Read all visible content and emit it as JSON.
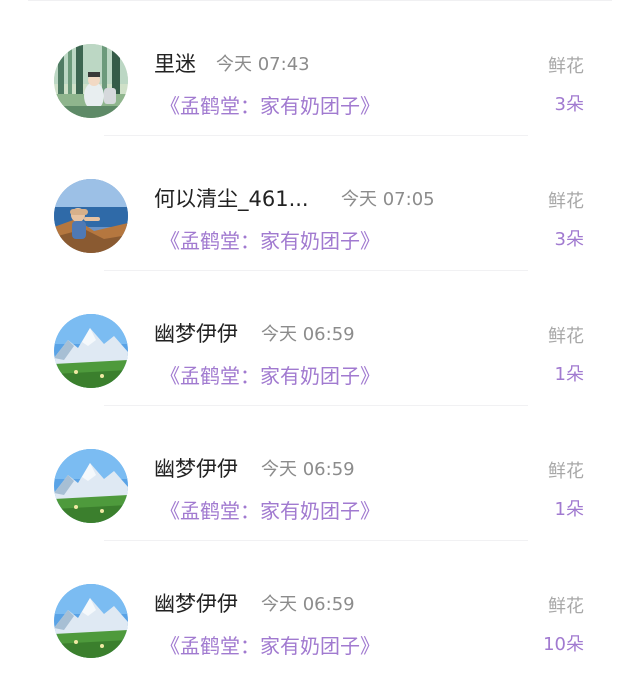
{
  "items": [
    {
      "avatar": "forest-illustration-avatar",
      "name": "里迷",
      "time": "今天 07:43",
      "book": "《孟鹤堂：家有奶团子》",
      "gift_label": "鲜花",
      "gift_count": "3朵"
    },
    {
      "avatar": "sea-photo-avatar",
      "name": "何以清尘_461...",
      "time": "今天 07:05",
      "book": "《孟鹤堂：家有奶团子》",
      "gift_label": "鲜花",
      "gift_count": "3朵"
    },
    {
      "avatar": "mountain-photo-avatar",
      "name": "幽梦伊伊",
      "time": "今天 06:59",
      "book": "《孟鹤堂：家有奶团子》",
      "gift_label": "鲜花",
      "gift_count": "1朵"
    },
    {
      "avatar": "mountain-photo-avatar",
      "name": "幽梦伊伊",
      "time": "今天 06:59",
      "book": "《孟鹤堂：家有奶团子》",
      "gift_label": "鲜花",
      "gift_count": "1朵"
    },
    {
      "avatar": "mountain-photo-avatar",
      "name": "幽梦伊伊",
      "time": "今天 06:59",
      "book": "《孟鹤堂：家有奶团子》",
      "gift_label": "鲜花",
      "gift_count": "10朵"
    }
  ],
  "colors": {
    "accent": "#a17ad0",
    "name": "#222222",
    "time": "#8c8c8c",
    "gift_label": "#a8a8a8"
  }
}
